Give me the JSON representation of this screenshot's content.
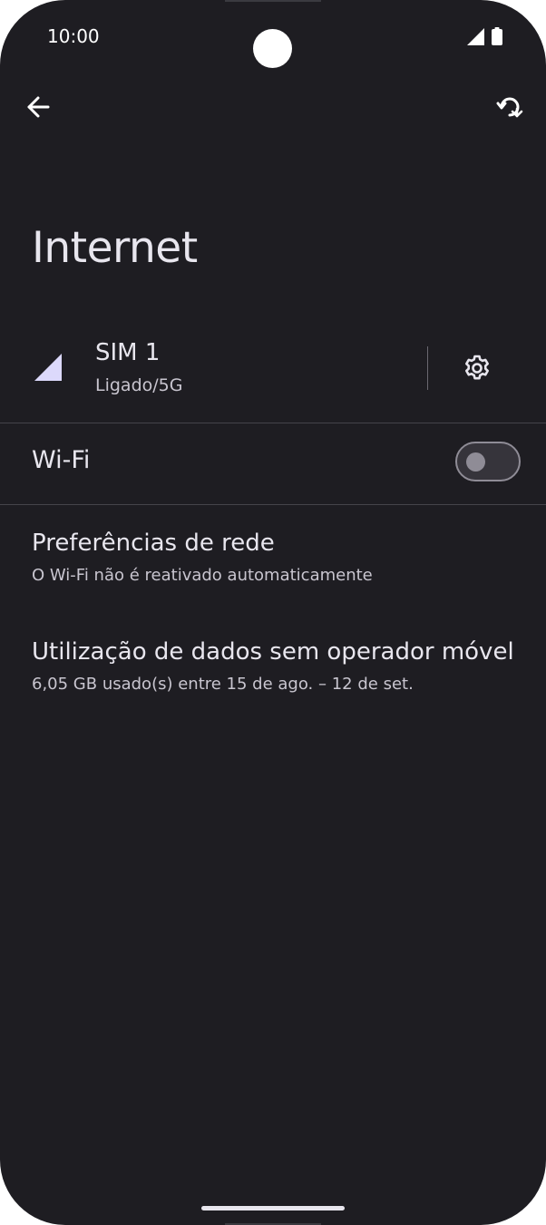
{
  "status_bar": {
    "time": "10:00"
  },
  "app_bar": {
    "back_icon": "arrow-back-icon",
    "help_icon": "help-refresh-icon"
  },
  "page": {
    "title": "Internet"
  },
  "sim": {
    "title": "SIM 1",
    "subtitle": "Ligado/5G",
    "signal_icon": "signal-icon",
    "settings_icon": "gear-icon"
  },
  "wifi": {
    "label": "Wi-Fi",
    "enabled": false
  },
  "items": [
    {
      "title": "Preferências de rede",
      "subtitle": "O Wi-Fi não é reativado automaticamente"
    },
    {
      "title": "Utilização de dados sem operador móvel",
      "subtitle": "6,05 GB usado(s) entre 15 de ago. – 12 de set."
    }
  ],
  "colors": {
    "background": "#1e1d22",
    "text_primary": "#e8e6ee",
    "text_secondary": "#c8c5cf",
    "signal_fill": "#dcd9fb",
    "toggle_off": "#8f8c96"
  }
}
